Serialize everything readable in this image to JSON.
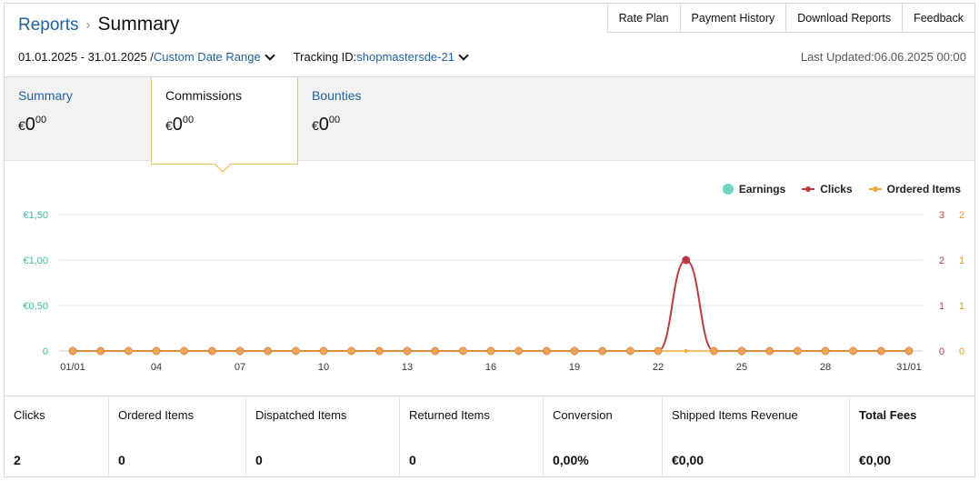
{
  "breadcrumb": {
    "parent": "Reports",
    "separator": "›",
    "current": "Summary"
  },
  "top_tabs": [
    "Rate Plan",
    "Payment History",
    "Download Reports",
    "Feedback"
  ],
  "filters": {
    "date_range": "01.01.2025 - 31.01.2025 /",
    "date_range_link": "Custom Date Range",
    "tracking_label": "Tracking ID:",
    "tracking_id": "shopmastersde-21",
    "last_updated": "Last Updated:06.06.2025 00:00"
  },
  "metric_tabs": [
    {
      "title": "Summary",
      "currency": "€",
      "whole": "0",
      "cents": "00"
    },
    {
      "title": "Commissions",
      "currency": "€",
      "whole": "0",
      "cents": "00"
    },
    {
      "title": "Bounties",
      "currency": "€",
      "whole": "0",
      "cents": "00"
    }
  ],
  "legend": {
    "earnings": "Earnings",
    "clicks": "Clicks",
    "ordered": "Ordered Items"
  },
  "colors": {
    "earnings": "#6ed6c0",
    "clicks": "#b83c45",
    "ordered": "#f0a93b",
    "link": "#2162a1",
    "active_border": "#f0c36d"
  },
  "chart_data": {
    "type": "line",
    "x": [
      "01/01",
      "02/01",
      "03/01",
      "04/01",
      "05/01",
      "06/01",
      "07/01",
      "08/01",
      "09/01",
      "10/01",
      "11/01",
      "12/01",
      "13/01",
      "14/01",
      "15/01",
      "16/01",
      "17/01",
      "18/01",
      "19/01",
      "20/01",
      "21/01",
      "22/01",
      "23/01",
      "24/01",
      "25/01",
      "26/01",
      "27/01",
      "28/01",
      "29/01",
      "30/01",
      "31/01"
    ],
    "x_tick_labels": [
      "01/01",
      "04",
      "07",
      "10",
      "13",
      "16",
      "19",
      "22",
      "25",
      "28",
      "31/01"
    ],
    "y_left_ticks": [
      "€1,50",
      "€1,00",
      "€0,50",
      "0"
    ],
    "y_clicks_ticks": [
      "3",
      "2",
      "1",
      "0"
    ],
    "y_ordered_ticks": [
      "2",
      "1",
      "1",
      "0"
    ],
    "y_left_range": [
      0,
      1.5
    ],
    "y_clicks_range": [
      0,
      3
    ],
    "y_ordered_range": [
      0,
      2
    ],
    "grid": true,
    "legend_position": "top-right",
    "series": [
      {
        "name": "Earnings",
        "axis": "left",
        "values": [
          0,
          0,
          0,
          0,
          0,
          0,
          0,
          0,
          0,
          0,
          0,
          0,
          0,
          0,
          0,
          0,
          0,
          0,
          0,
          0,
          0,
          0,
          0,
          0,
          0,
          0,
          0,
          0,
          0,
          0,
          0
        ]
      },
      {
        "name": "Clicks",
        "axis": "clicks",
        "values": [
          0,
          0,
          0,
          0,
          0,
          0,
          0,
          0,
          0,
          0,
          0,
          0,
          0,
          0,
          0,
          0,
          0,
          0,
          0,
          0,
          0,
          0,
          2,
          0,
          0,
          0,
          0,
          0,
          0,
          0,
          0
        ]
      },
      {
        "name": "Ordered Items",
        "axis": "ordered",
        "values": [
          0,
          0,
          0,
          0,
          0,
          0,
          0,
          0,
          0,
          0,
          0,
          0,
          0,
          0,
          0,
          0,
          0,
          0,
          0,
          0,
          0,
          0,
          0,
          0,
          0,
          0,
          0,
          0,
          0,
          0,
          0
        ]
      }
    ]
  },
  "stats": [
    {
      "label": "Clicks",
      "value": "2",
      "bold_label": false
    },
    {
      "label": "Ordered Items",
      "value": "0",
      "bold_label": false
    },
    {
      "label": "Dispatched Items",
      "value": "0",
      "bold_label": false
    },
    {
      "label": "Returned Items",
      "value": "0",
      "bold_label": false
    },
    {
      "label": "Conversion",
      "value": "0,00%",
      "bold_label": false
    },
    {
      "label": "Shipped Items Revenue",
      "value": "€0,00",
      "bold_label": false
    },
    {
      "label": "Total Fees",
      "value": "€0,00",
      "bold_label": true
    }
  ]
}
